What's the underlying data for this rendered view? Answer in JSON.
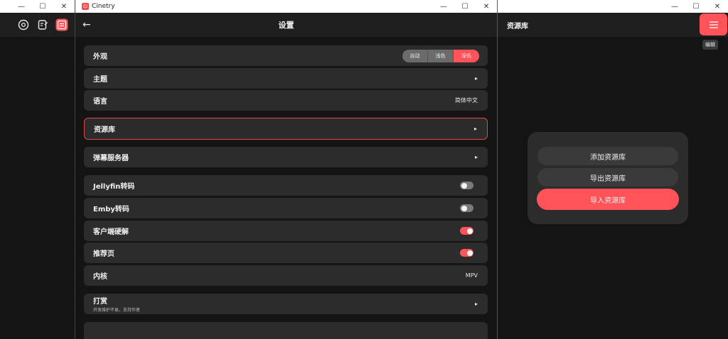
{
  "left_window": {
    "controls": {
      "minimize": "—",
      "maximize": "☐",
      "close": "✕"
    },
    "icons": [
      "search-icon",
      "edit-doc-icon",
      "library-swap-icon"
    ]
  },
  "mid_window": {
    "app_name": "Cinetry",
    "app_logo_text": "Ci",
    "controls": {
      "minimize": "—",
      "maximize": "☐",
      "close": "✕"
    },
    "back_glyph": "←",
    "title": "设置",
    "rows": {
      "appearance": {
        "label": "外观",
        "options": [
          "自动",
          "浅色",
          "深色"
        ],
        "selected": "深色"
      },
      "theme": {
        "label": "主题"
      },
      "language": {
        "label": "语言",
        "value": "简体中文"
      },
      "library": {
        "label": "资源库"
      },
      "danmaku": {
        "label": "弹幕服务器"
      },
      "jellyfin": {
        "label": "Jellyfin转码",
        "on": false
      },
      "emby": {
        "label": "Emby转码",
        "on": false
      },
      "hwdecode": {
        "label": "客户端硬解",
        "on": true
      },
      "recommend": {
        "label": "推荐页",
        "on": true
      },
      "core": {
        "label": "内核",
        "value": "MPV"
      },
      "donate": {
        "label": "打赏",
        "sub": "开发维护不易，支持作者"
      }
    },
    "arrow_glyph": "▸",
    "accent": "#ff5259"
  },
  "right_window": {
    "controls": {
      "minimize": "—",
      "maximize": "☐",
      "close": "✕"
    },
    "title": "资源库",
    "tooltip": "编辑",
    "menu_icon": "menu-icon",
    "dialog": {
      "add": "添加资源库",
      "export": "导出资源库",
      "import": "导入资源库"
    }
  }
}
